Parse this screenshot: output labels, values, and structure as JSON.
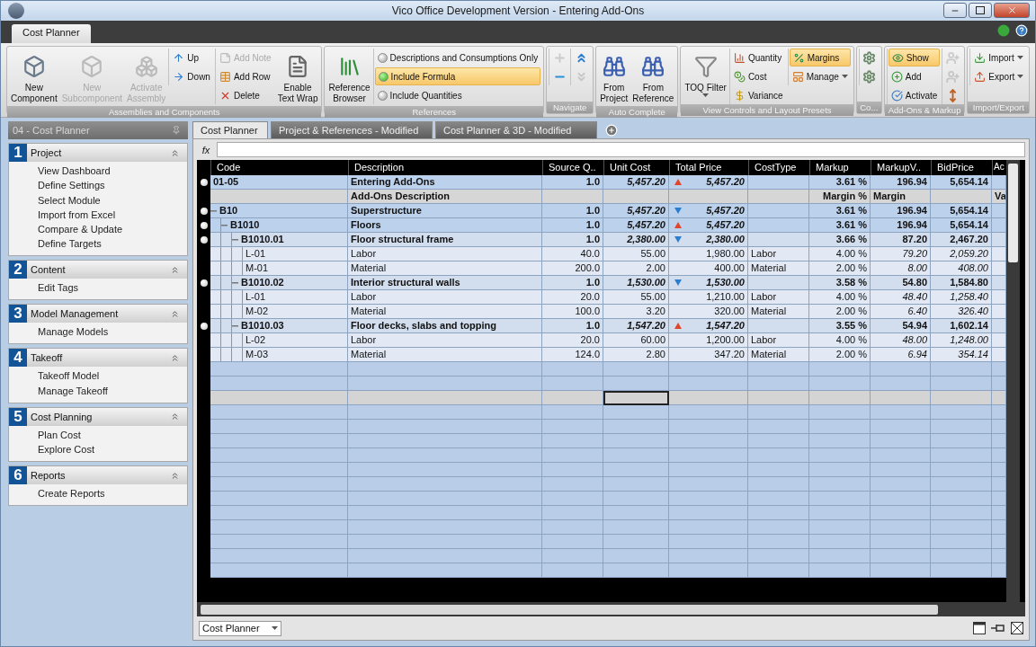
{
  "window": {
    "title": "Vico Office Development Version - Entering Add-Ons"
  },
  "ribbon_tabs": [
    {
      "label": "Cost Planner",
      "selected": true
    }
  ],
  "ribbon_groups": [
    {
      "label": "Assemblies and Components",
      "columns": [
        {
          "kind": "large",
          "label": "New\nComponent",
          "disabled": false
        },
        {
          "kind": "large",
          "label": "New\nSubcomponent",
          "disabled": true
        },
        {
          "kind": "large",
          "label": "Activate\nAssembly",
          "disabled": true
        },
        {
          "kind": "stack",
          "items": [
            {
              "kind": "button",
              "label": "Up",
              "disabled": false,
              "selected": false
            },
            {
              "kind": "button",
              "label": "Down",
              "disabled": false,
              "selected": false
            }
          ]
        },
        {
          "kind": "stack",
          "items": [
            {
              "kind": "button",
              "label": "Add Note",
              "disabled": true,
              "selected": false
            },
            {
              "kind": "button",
              "label": "Add Row",
              "disabled": false,
              "selected": false
            },
            {
              "kind": "button",
              "label": "Delete",
              "disabled": false,
              "selected": false
            }
          ]
        },
        {
          "kind": "large",
          "label": "Enable\nText Wrap",
          "disabled": false
        }
      ]
    },
    {
      "label": "References",
      "columns": [
        {
          "kind": "large",
          "label": "Reference\nBrowser",
          "disabled": false
        },
        {
          "kind": "stack",
          "items": [
            {
              "kind": "radio",
              "label": "Descriptions and Consumptions Only",
              "disabled": false,
              "selected": false
            },
            {
              "kind": "radio",
              "label": "Include Formula",
              "disabled": false,
              "selected": true
            },
            {
              "kind": "radio",
              "label": "Include Quantities",
              "disabled": false,
              "selected": false
            }
          ]
        }
      ]
    },
    {
      "label": "Navigate",
      "columns": [
        {
          "kind": "icons",
          "items": [
            {
              "disabled": true
            },
            {
              "disabled": false
            }
          ]
        },
        {
          "kind": "icons",
          "items": [
            {
              "disabled": false
            },
            {
              "disabled": true
            }
          ]
        }
      ]
    },
    {
      "label": "Auto Complete",
      "columns": [
        {
          "kind": "large",
          "label": "From\nProject",
          "disabled": false
        },
        {
          "kind": "large",
          "label": "From\nReference",
          "disabled": false
        }
      ]
    },
    {
      "label": "View Controls and Layout Presets",
      "columns": [
        {
          "kind": "large",
          "label": "TOQ Filter",
          "disabled": false,
          "dropdown": true
        },
        {
          "kind": "stack",
          "items": [
            {
              "kind": "button",
              "label": "Quantity",
              "disabled": false,
              "selected": false
            },
            {
              "kind": "button",
              "label": "Cost",
              "disabled": false,
              "selected": false
            },
            {
              "kind": "button",
              "label": "Variance",
              "disabled": false,
              "selected": false
            }
          ]
        },
        {
          "kind": "stack",
          "items": [
            {
              "kind": "button",
              "label": "Margins",
              "disabled": false,
              "selected": true
            },
            {
              "kind": "button",
              "label": "Manage",
              "disabled": false,
              "selected": false,
              "dropdown": true
            }
          ]
        }
      ]
    },
    {
      "label": "Co...",
      "columns": [
        {
          "kind": "icons",
          "items": [
            {
              "disabled": false
            },
            {
              "disabled": false
            }
          ]
        }
      ]
    },
    {
      "label": "Add-Ons & Markup",
      "columns": [
        {
          "kind": "stack",
          "items": [
            {
              "kind": "button",
              "label": "Show",
              "disabled": false,
              "selected": true
            },
            {
              "kind": "button",
              "label": "Add",
              "disabled": false,
              "selected": false
            },
            {
              "kind": "button",
              "label": "Activate",
              "disabled": false,
              "selected": false
            }
          ]
        },
        {
          "kind": "icons",
          "items": [
            {
              "disabled": true
            },
            {
              "disabled": true
            },
            {
              "disabled": false
            }
          ]
        }
      ]
    },
    {
      "label": "Import/Export",
      "columns": [
        {
          "kind": "stack",
          "items": [
            {
              "kind": "button",
              "label": "Import",
              "disabled": false,
              "selected": false,
              "dropdown": true
            },
            {
              "kind": "button",
              "label": "Export",
              "disabled": false,
              "selected": false,
              "dropdown": true
            }
          ]
        }
      ]
    }
  ],
  "sidebar": {
    "title": "04 - Cost Planner",
    "sections": [
      {
        "number": "1",
        "title": "Project",
        "expanded": true,
        "items": [
          "View Dashboard",
          "Define Settings",
          "Select Module",
          "Import from Excel",
          "Compare & Update",
          "Define Targets"
        ]
      },
      {
        "number": "2",
        "title": "Content",
        "expanded": true,
        "items": [
          "Edit Tags"
        ]
      },
      {
        "number": "3",
        "title": "Model Management",
        "expanded": true,
        "items": [
          "Manage Models"
        ]
      },
      {
        "number": "4",
        "title": "Takeoff",
        "expanded": true,
        "items": [
          "Takeoff Model",
          "Manage Takeoff"
        ]
      },
      {
        "number": "5",
        "title": "Cost Planning",
        "expanded": true,
        "items": [
          "Plan Cost",
          "Explore Cost"
        ]
      },
      {
        "number": "6",
        "title": "Reports",
        "expanded": true,
        "items": [
          "Create Reports"
        ]
      }
    ]
  },
  "document_tabs": [
    {
      "label": "Cost Planner",
      "selected": true
    },
    {
      "label": "Project & References - Modified",
      "selected": false
    },
    {
      "label": "Cost Planner & 3D - Modified",
      "selected": false
    }
  ],
  "formula_bar": {
    "label": "fx"
  },
  "table": {
    "columns": [
      "Code",
      "Description",
      "Source Q..",
      "Unit Cost",
      "Total Price",
      "CostType",
      "Markup",
      "MarkupV..",
      "BidPrice",
      "Ac"
    ],
    "rows": [
      {
        "kind": "group",
        "bullet": true,
        "code": "01-05",
        "description": "Entering Add-Ons",
        "source_qty": "1.0",
        "unit_cost": "5,457.20",
        "increase": true,
        "total_price": "5,457.20",
        "markup": "3.61 %",
        "markup_value": "196.94",
        "bid_price": "5,654.14"
      },
      {
        "kind": "addon",
        "bullet": false,
        "description": "Add-Ons Description",
        "markup": "Margin %",
        "markup_value": "Margin",
        "ac": "Va"
      },
      {
        "kind": "group",
        "bullet": true,
        "expanded": true,
        "code": "B10",
        "description": "Superstructure",
        "source_qty": "1.0",
        "unit_cost": "5,457.20",
        "increase": false,
        "total_price": "5,457.20",
        "markup": "3.61 %",
        "markup_value": "196.94",
        "bid_price": "5,654.14",
        "children": [
          {
            "kind": "group",
            "bullet": true,
            "expanded": true,
            "code": "B1010",
            "description": "Floors",
            "source_qty": "1.0",
            "unit_cost": "5,457.20",
            "increase": true,
            "total_price": "5,457.20",
            "markup": "3.61 %",
            "markup_value": "196.94",
            "bid_price": "5,654.14",
            "children": [
              {
                "kind": "group",
                "bullet": true,
                "expanded": true,
                "code": "B1010.01",
                "description": "Floor structural frame",
                "source_qty": "1.0",
                "unit_cost": "2,380.00",
                "increase": false,
                "total_price": "2,380.00",
                "markup": "3.66 %",
                "markup_value": "87.20",
                "bid_price": "2,467.20",
                "children": [
                  {
                    "kind": "item",
                    "bullet": false,
                    "code": "L-01",
                    "description": "Labor",
                    "source_qty": "40.0",
                    "unit_cost": "55.00",
                    "total_price": "1,980.00",
                    "cost_type": "Labor",
                    "markup": "4.00 %",
                    "markup_value": "79.20",
                    "bid_price": "2,059.20"
                  },
                  {
                    "kind": "item",
                    "bullet": false,
                    "code": "M-01",
                    "description": "Material",
                    "source_qty": "200.0",
                    "unit_cost": "2.00",
                    "total_price": "400.00",
                    "cost_type": "Material",
                    "markup": "2.00 %",
                    "markup_value": "8.00",
                    "bid_price": "408.00"
                  }
                ]
              },
              {
                "kind": "group",
                "bullet": true,
                "expanded": true,
                "code": "B1010.02",
                "description": "Interior structural walls",
                "source_qty": "1.0",
                "unit_cost": "1,530.00",
                "increase": false,
                "total_price": "1,530.00",
                "markup": "3.58 %",
                "markup_value": "54.80",
                "bid_price": "1,584.80",
                "children": [
                  {
                    "kind": "item",
                    "bullet": false,
                    "code": "L-01",
                    "description": "Labor",
                    "source_qty": "20.0",
                    "unit_cost": "55.00",
                    "total_price": "1,210.00",
                    "cost_type": "Labor",
                    "markup": "4.00 %",
                    "markup_value": "48.40",
                    "bid_price": "1,258.40"
                  },
                  {
                    "kind": "item",
                    "bullet": false,
                    "code": "M-02",
                    "description": "Material",
                    "source_qty": "100.0",
                    "unit_cost": "3.20",
                    "total_price": "320.00",
                    "cost_type": "Material",
                    "markup": "2.00 %",
                    "markup_value": "6.40",
                    "bid_price": "326.40"
                  }
                ]
              },
              {
                "kind": "group",
                "bullet": true,
                "expanded": true,
                "code": "B1010.03",
                "description": "Floor decks, slabs and topping",
                "source_qty": "1.0",
                "unit_cost": "1,547.20",
                "increase": true,
                "total_price": "1,547.20",
                "markup": "3.55 %",
                "markup_value": "54.94",
                "bid_price": "1,602.14",
                "children": [
                  {
                    "kind": "item",
                    "bullet": false,
                    "code": "L-02",
                    "description": "Labor",
                    "source_qty": "20.0",
                    "unit_cost": "60.00",
                    "total_price": "1,200.00",
                    "cost_type": "Labor",
                    "markup": "4.00 %",
                    "markup_value": "48.00",
                    "bid_price": "1,248.00"
                  },
                  {
                    "kind": "item",
                    "bullet": false,
                    "code": "M-03",
                    "description": "Material",
                    "source_qty": "124.0",
                    "unit_cost": "2.80",
                    "total_price": "347.20",
                    "cost_type": "Material",
                    "markup": "2.00 %",
                    "markup_value": "6.94",
                    "bid_price": "354.14"
                  }
                ]
              }
            ]
          }
        ]
      }
    ],
    "blank_rows": [
      {
        "selected": false
      },
      {
        "selected": false
      },
      {
        "selected": true
      },
      {
        "selected": false
      },
      {
        "selected": false
      },
      {
        "selected": false
      },
      {
        "selected": false
      },
      {
        "selected": false
      },
      {
        "selected": false
      },
      {
        "selected": false
      },
      {
        "selected": false
      },
      {
        "selected": false
      },
      {
        "selected": false
      },
      {
        "selected": false
      },
      {
        "selected": false
      }
    ]
  },
  "bottom_bar": {
    "view_select": "Cost Planner"
  }
}
